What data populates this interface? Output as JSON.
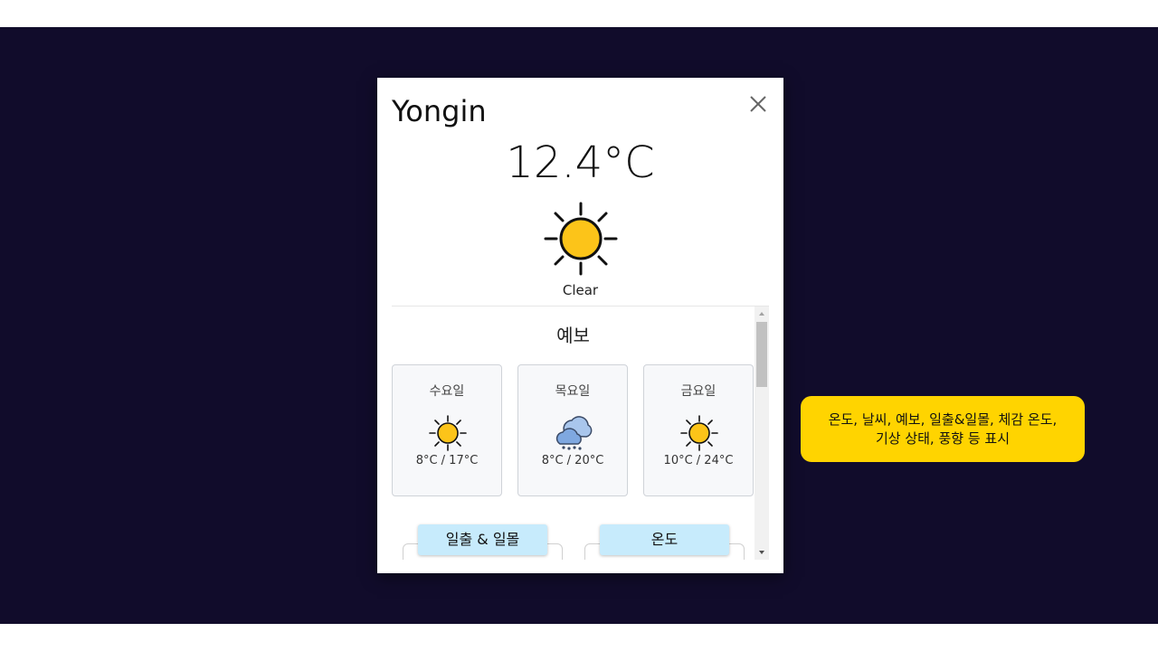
{
  "weather": {
    "city": "Yongin",
    "temperature": "12.4°C",
    "condition": "Clear",
    "main_icon": "sun-icon"
  },
  "forecast": {
    "title": "예보",
    "days": [
      {
        "day": "수요일",
        "icon": "sun-icon",
        "range": "8°C / 17°C"
      },
      {
        "day": "목요일",
        "icon": "cloud-rain-icon",
        "range": "8°C / 20°C"
      },
      {
        "day": "금요일",
        "icon": "sun-icon",
        "range": "10°C / 24°C"
      }
    ]
  },
  "panels": {
    "sunrise_sunset": "일출 & 일몰",
    "temperature": "온도"
  },
  "annotation": {
    "line1": "온도, 날씨, 예보, 일출&일몰, 체감 온도,",
    "line2": "기상 상태, 풍향 등 표시"
  },
  "colors": {
    "backdrop": "#110c2b",
    "sun": "#fcc419",
    "pill": "#c7ebfc",
    "tooltip": "#ffd400"
  }
}
